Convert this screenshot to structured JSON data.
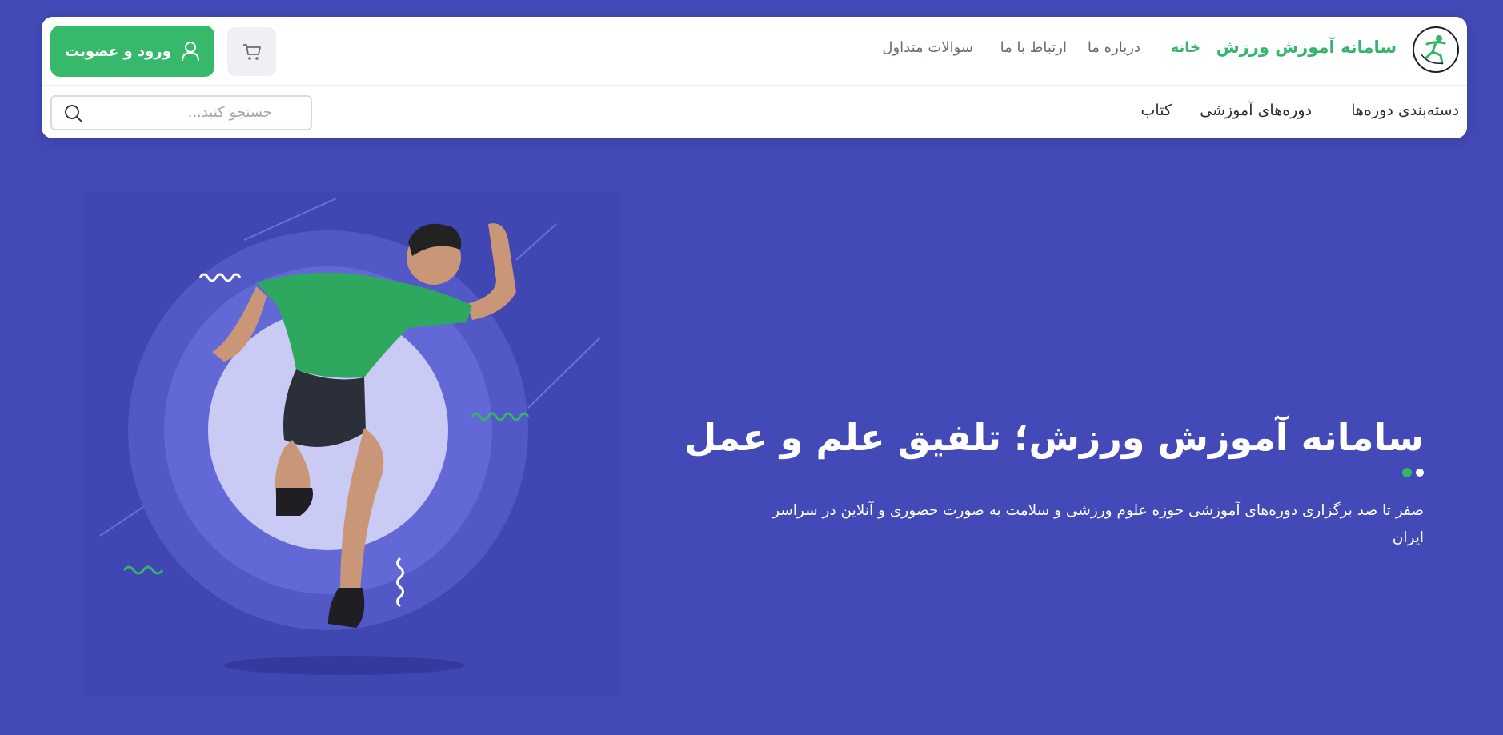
{
  "colors": {
    "background": "#4349b6",
    "accent": "#33b56a",
    "button": "#37b96b",
    "header_bg": "#ffffff"
  },
  "header": {
    "brand": "سامانه آموزش ورزش",
    "nav": [
      {
        "label": "خانه",
        "active": true
      },
      {
        "label": "درباره ما"
      },
      {
        "label": "ارتباط با ما"
      },
      {
        "label": "سوالات متداول"
      }
    ],
    "cart_icon": "cart-icon",
    "login_label": "ورود و عضویت",
    "secondary_nav": [
      "دسته‌بندی دوره‌ها",
      "دوره‌های آموزشی",
      "کتاب"
    ],
    "search_placeholder": "جستجو کنید..."
  },
  "hero": {
    "title": "سامانه آموزش ورزش؛ تلفیق علم و عمل",
    "description": "صفر تا صد برگزاری دوره‌های آموزشی حوزه علوم ورزشی و سلامت به صورت حضوری و آنلاین در سراسر ایران"
  }
}
